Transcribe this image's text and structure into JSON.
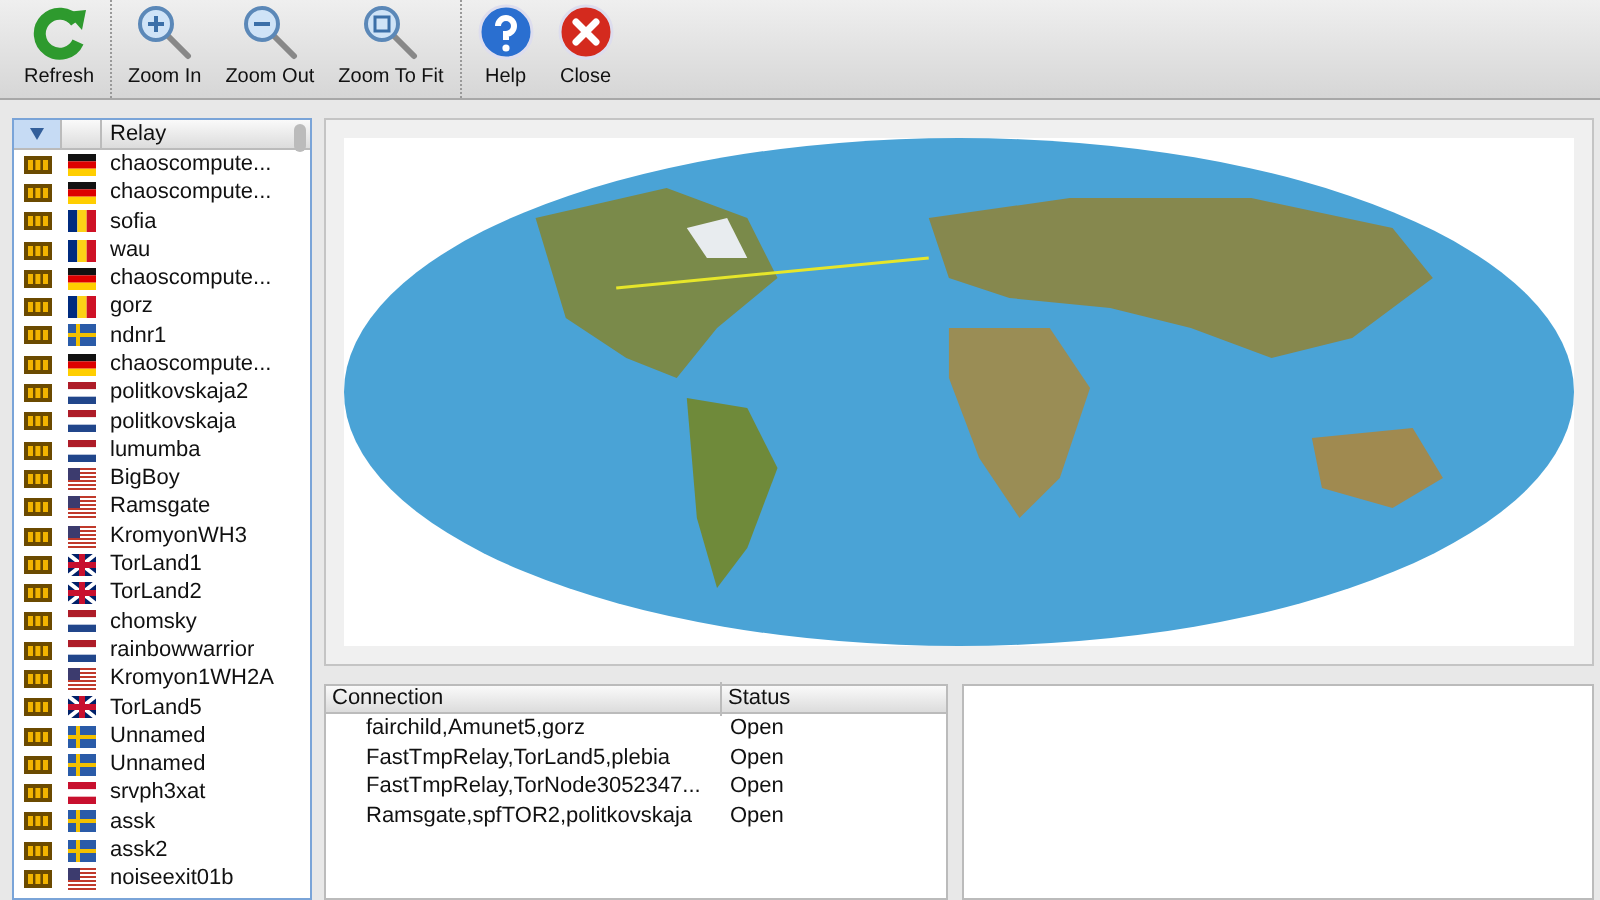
{
  "toolbar": [
    [
      {
        "kind": "refresh",
        "label": "Refresh"
      }
    ],
    [
      {
        "kind": "zoom_in",
        "label": "Zoom In"
      },
      {
        "kind": "zoom_out",
        "label": "Zoom Out"
      },
      {
        "kind": "zoom_fit",
        "label": "Zoom To Fit"
      }
    ],
    [
      {
        "kind": "help",
        "label": "Help"
      },
      {
        "kind": "close",
        "label": "Close"
      }
    ]
  ],
  "relay_list": {
    "column": "Relay",
    "rows": [
      {
        "name": "chaoscompute...",
        "kind": "de"
      },
      {
        "name": "chaoscompute...",
        "kind": "de"
      },
      {
        "name": "sofia",
        "kind": "ro"
      },
      {
        "name": "wau",
        "kind": "ro"
      },
      {
        "name": "chaoscompute...",
        "kind": "de"
      },
      {
        "name": "gorz",
        "kind": "ro"
      },
      {
        "name": "ndnr1",
        "kind": "se"
      },
      {
        "name": "chaoscompute...",
        "kind": "de"
      },
      {
        "name": "politkovskaja2",
        "kind": "nl"
      },
      {
        "name": "politkovskaja",
        "kind": "nl"
      },
      {
        "name": "lumumba",
        "kind": "nl"
      },
      {
        "name": "BigBoy",
        "kind": "us"
      },
      {
        "name": "Ramsgate",
        "kind": "us"
      },
      {
        "name": "KromyonWH3",
        "kind": "us"
      },
      {
        "name": "TorLand1",
        "kind": "gb"
      },
      {
        "name": "TorLand2",
        "kind": "gb"
      },
      {
        "name": "chomsky",
        "kind": "nl"
      },
      {
        "name": "rainbowwarrior",
        "kind": "nl"
      },
      {
        "name": "Kromyon1WH2A",
        "kind": "us"
      },
      {
        "name": "TorLand5",
        "kind": "gb"
      },
      {
        "name": "Unnamed",
        "kind": "se"
      },
      {
        "name": "Unnamed",
        "kind": "se"
      },
      {
        "name": "srvph3xat",
        "kind": "at"
      },
      {
        "name": "assk",
        "kind": "se"
      },
      {
        "name": "assk2",
        "kind": "se"
      },
      {
        "name": "noiseexit01b",
        "kind": "us"
      }
    ]
  },
  "connections": {
    "columns": [
      "Connection",
      "Status"
    ],
    "rows": [
      {
        "connection": "fairchild,Amunet5,gorz",
        "status": "Open"
      },
      {
        "connection": "FastTmpRelay,TorLand5,plebia",
        "status": "Open"
      },
      {
        "connection": "FastTmpRelay,TorNode3052347...",
        "status": "Open"
      },
      {
        "connection": "Ramsgate,spfTOR2,politkovskaja",
        "status": "Open"
      }
    ]
  }
}
